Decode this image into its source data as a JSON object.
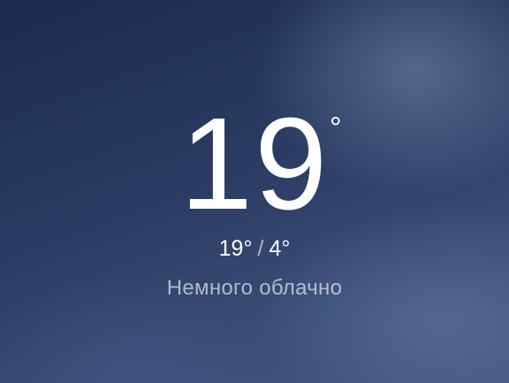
{
  "weather": {
    "current_temp": "19",
    "degree_symbol": "°",
    "high": "19°",
    "separator": "/",
    "low": "4°",
    "condition": "Немного облачно"
  },
  "colors": {
    "text_primary": "#ffffff",
    "background_top": "#1b2a4d",
    "background_bottom": "#43597f"
  }
}
